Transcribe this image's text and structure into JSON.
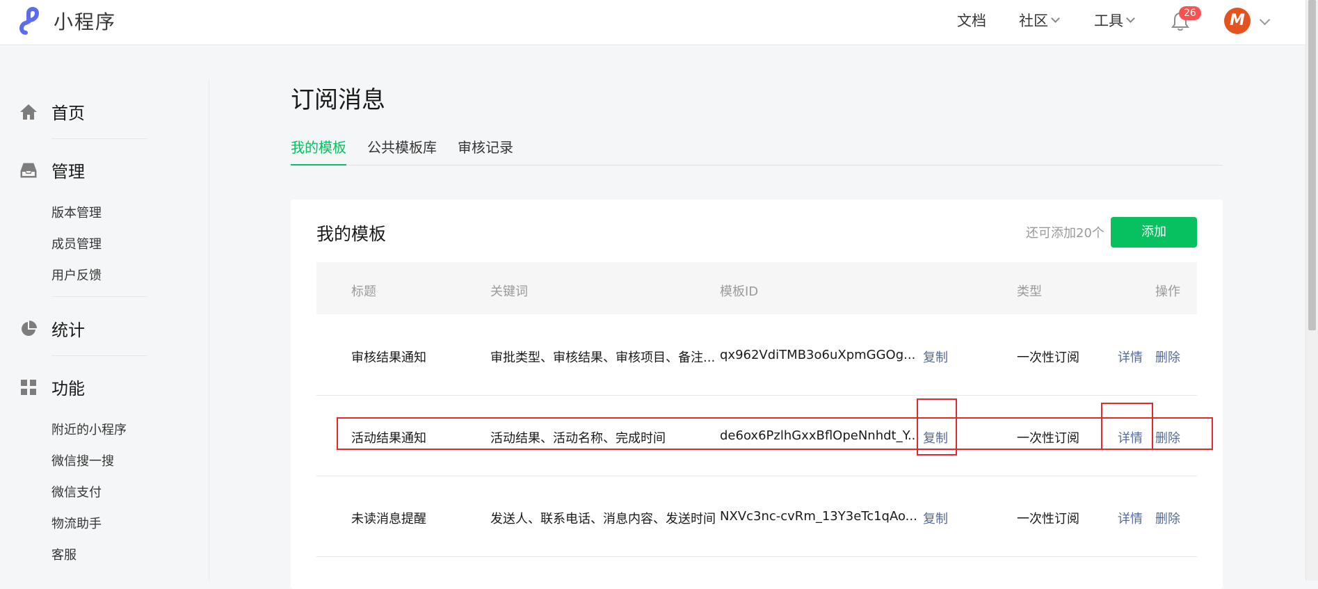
{
  "header": {
    "app_name": "小程序",
    "nav": [
      "文档",
      "社区",
      "工具"
    ],
    "notification_count": "26",
    "avatar_letter": "M"
  },
  "sidebar": {
    "sections": [
      {
        "label": "首页",
        "icon": "home-icon"
      },
      {
        "label": "管理",
        "icon": "inbox-icon",
        "items": [
          "版本管理",
          "成员管理",
          "用户反馈"
        ]
      },
      {
        "label": "统计",
        "icon": "pie-chart-icon"
      },
      {
        "label": "功能",
        "icon": "grid-icon",
        "items": [
          "附近的小程序",
          "微信搜一搜",
          "微信支付",
          "物流助手",
          "客服"
        ]
      }
    ]
  },
  "page": {
    "title": "订阅消息",
    "tabs": [
      "我的模板",
      "公共模板库",
      "审核记录"
    ],
    "active_tab": 0
  },
  "card": {
    "title": "我的模板",
    "quota": "还可添加20个",
    "add_label": "添加"
  },
  "table": {
    "headers": [
      "标题",
      "关键词",
      "模板ID",
      "类型",
      "操作"
    ],
    "rows": [
      {
        "title": "审核结果通知",
        "keywords": "审批类型、审核结果、审核项目、备注...",
        "template_id": "qx962VdiTMB3o6uXpmGGOg...",
        "copy": "复制",
        "type": "一次性订阅",
        "detail": "详情",
        "delete": "删除"
      },
      {
        "title": "活动结果通知",
        "keywords": "活动结果、活动名称、完成时间",
        "template_id": "de6ox6PzlhGxxBflOpeNnhdt_Y...",
        "copy": "复制",
        "type": "一次性订阅",
        "detail": "详情",
        "delete": "删除"
      },
      {
        "title": "未读消息提醒",
        "keywords": "发送人、联系电话、消息内容、发送时间",
        "template_id": "NXVc3nc-cvRm_13Y3eTc1qAo...",
        "copy": "复制",
        "type": "一次性订阅",
        "detail": "详情",
        "delete": "删除"
      }
    ]
  },
  "colors": {
    "accent": "#07c160",
    "link": "#576b95",
    "highlight": "#e8262d",
    "badge": "#fa5151",
    "avatar": "#e2531f"
  }
}
